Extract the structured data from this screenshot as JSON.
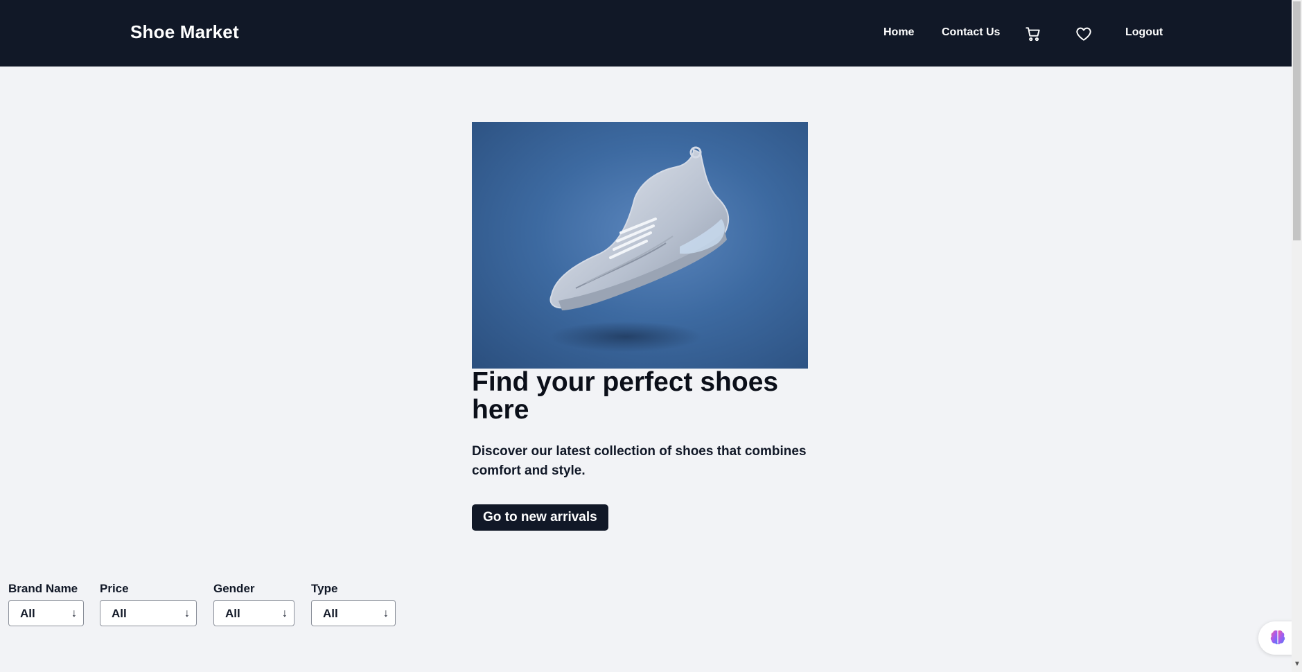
{
  "header": {
    "brand": "Shoe Market",
    "nav": {
      "home": "Home",
      "contact": "Contact Us",
      "logout": "Logout"
    },
    "icons": {
      "cart": "cart-icon",
      "wishlist": "heart-icon"
    }
  },
  "hero": {
    "title": "Find your perfect shoes here",
    "description": "Discover our latest collection of shoes that combines comfort and style.",
    "cta": "Go to new arrivals"
  },
  "filters": [
    {
      "label": "Brand Name",
      "value": "All"
    },
    {
      "label": "Price",
      "value": "All"
    },
    {
      "label": "Gender",
      "value": "All"
    },
    {
      "label": "Type",
      "value": "All"
    }
  ],
  "colors": {
    "navbar": "#111827",
    "background": "#f2f3f6",
    "button": "#111827"
  }
}
